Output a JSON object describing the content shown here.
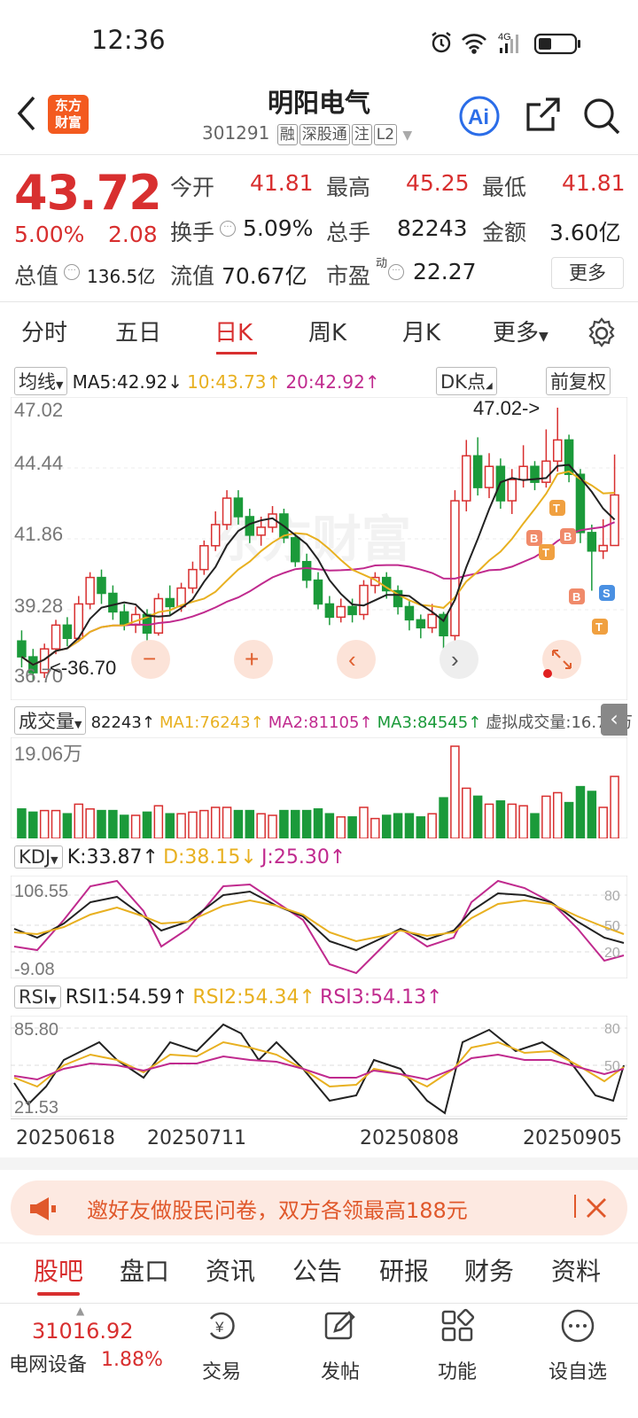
{
  "status": {
    "time": "12:36"
  },
  "header": {
    "logo_line1": "东方",
    "logo_line2": "财富",
    "title": "明阳电气",
    "code": "301291",
    "tags": [
      "融",
      "深股通",
      "注",
      "L2"
    ]
  },
  "quote": {
    "price": "43.72",
    "change_pct": "5.00%",
    "change": "2.08",
    "open_label": "今开",
    "open": "41.81",
    "high_label": "最高",
    "high": "45.25",
    "low_label": "最低",
    "low": "41.81",
    "turnover_label": "换手",
    "turnover": "5.09%",
    "vol_label": "总手",
    "vol": "82243",
    "amount_label": "金额",
    "amount": "3.60亿",
    "mktcap_label": "总值",
    "mktcap": "136.5亿",
    "float_label": "流值",
    "float": "70.67亿",
    "pe_label": "市盈",
    "pe_sup": "动",
    "pe": "22.27",
    "more": "更多"
  },
  "tabs": [
    "分时",
    "五日",
    "日K",
    "周K",
    "月K",
    "更多"
  ],
  "kline": {
    "ma_select": "均线",
    "ma5": "MA5:42.92↓",
    "ma10": "10:43.73↑",
    "ma20": "20:42.92↑",
    "dk": "DK点",
    "adjust": "前复权",
    "y_labels": [
      "47.02",
      "44.44",
      "41.86",
      "39.28",
      "36.70"
    ],
    "high_marker": "47.02->",
    "low_marker": "<-36.70",
    "watermark": "东方财富"
  },
  "volume": {
    "select": "成交量",
    "val": "82243↑",
    "ma1": "MA1:76243↑",
    "ma2": "MA2:81105↑",
    "ma3": "MA3:84545↑",
    "virtual": "虚拟成交量:16.78万",
    "max_label": "19.06万"
  },
  "kdj": {
    "select": "KDJ",
    "k": "K:33.87↑",
    "d": "D:38.15↓",
    "j": "J:25.30↑",
    "top": "106.55",
    "bottom": "-9.08",
    "r80": "80",
    "r50": "50",
    "r20": "20"
  },
  "rsi": {
    "select": "RSI",
    "r1": "RSI1:54.59↑",
    "r2": "RSI2:54.34↑",
    "r3": "RSI3:54.13↑",
    "top": "85.80",
    "bottom": "21.53",
    "r80": "80",
    "r50": "50"
  },
  "dates": [
    "20250618",
    "20250711",
    "20250808",
    "20250905"
  ],
  "banner": {
    "text": "邀好友做股民问卷，双方各领最高188元"
  },
  "feature_tabs": [
    "股吧",
    "盘口",
    "资讯",
    "公告",
    "研报",
    "财务",
    "资料"
  ],
  "bottom": {
    "index_value": "31016.92",
    "index_name": "电网设备",
    "index_pct": "1.88%",
    "items": [
      "交易",
      "发帖",
      "功能",
      "设自选"
    ]
  },
  "colors": {
    "up": "#d82f2f",
    "down": "#1b9a3a",
    "ma5": "#222222",
    "ma10": "#e8b020",
    "ma20": "#c02a8e"
  },
  "chart_data": {
    "type": "candlestick",
    "ylim": [
      36.7,
      47.02
    ],
    "candles": [
      {
        "o": 38.2,
        "c": 37.6,
        "h": 38.6,
        "l": 37.2
      },
      {
        "o": 37.6,
        "c": 37.0,
        "h": 37.9,
        "l": 36.7
      },
      {
        "o": 37.0,
        "c": 37.9,
        "h": 38.1,
        "l": 36.8
      },
      {
        "o": 37.9,
        "c": 38.8,
        "h": 39.0,
        "l": 37.7
      },
      {
        "o": 38.8,
        "c": 38.3,
        "h": 39.1,
        "l": 38.0
      },
      {
        "o": 38.3,
        "c": 39.6,
        "h": 39.9,
        "l": 38.2
      },
      {
        "o": 39.6,
        "c": 40.6,
        "h": 40.8,
        "l": 39.4
      },
      {
        "o": 40.6,
        "c": 40.0,
        "h": 40.9,
        "l": 39.6
      },
      {
        "o": 40.0,
        "c": 39.3,
        "h": 40.3,
        "l": 39.0
      },
      {
        "o": 39.3,
        "c": 38.8,
        "h": 39.6,
        "l": 38.6
      },
      {
        "o": 38.8,
        "c": 39.2,
        "h": 39.5,
        "l": 38.5
      },
      {
        "o": 39.2,
        "c": 38.5,
        "h": 39.4,
        "l": 38.2
      },
      {
        "o": 38.5,
        "c": 39.8,
        "h": 40.0,
        "l": 38.4
      },
      {
        "o": 39.8,
        "c": 39.5,
        "h": 40.3,
        "l": 39.2
      },
      {
        "o": 39.5,
        "c": 40.2,
        "h": 40.4,
        "l": 39.3
      },
      {
        "o": 40.2,
        "c": 40.9,
        "h": 41.2,
        "l": 40.0
      },
      {
        "o": 40.9,
        "c": 41.8,
        "h": 42.0,
        "l": 40.7
      },
      {
        "o": 41.8,
        "c": 42.6,
        "h": 43.1,
        "l": 41.6
      },
      {
        "o": 42.6,
        "c": 43.6,
        "h": 43.9,
        "l": 42.4
      },
      {
        "o": 43.6,
        "c": 42.9,
        "h": 43.9,
        "l": 42.6
      },
      {
        "o": 42.9,
        "c": 42.2,
        "h": 43.2,
        "l": 41.9
      },
      {
        "o": 42.2,
        "c": 42.5,
        "h": 42.9,
        "l": 41.8
      },
      {
        "o": 42.5,
        "c": 43.0,
        "h": 43.3,
        "l": 42.3
      },
      {
        "o": 43.0,
        "c": 42.1,
        "h": 43.2,
        "l": 41.9
      },
      {
        "o": 42.1,
        "c": 41.2,
        "h": 42.3,
        "l": 41.0
      },
      {
        "o": 41.2,
        "c": 40.5,
        "h": 41.5,
        "l": 40.2
      },
      {
        "o": 40.5,
        "c": 39.6,
        "h": 40.8,
        "l": 39.4
      },
      {
        "o": 39.6,
        "c": 39.1,
        "h": 39.9,
        "l": 38.8
      },
      {
        "o": 39.1,
        "c": 39.5,
        "h": 39.8,
        "l": 38.9
      },
      {
        "o": 39.5,
        "c": 39.2,
        "h": 39.8,
        "l": 38.9
      },
      {
        "o": 39.2,
        "c": 40.3,
        "h": 40.5,
        "l": 39.0
      },
      {
        "o": 40.3,
        "c": 40.6,
        "h": 40.8,
        "l": 40.0
      },
      {
        "o": 40.6,
        "c": 40.1,
        "h": 40.8,
        "l": 39.8
      },
      {
        "o": 40.1,
        "c": 39.5,
        "h": 40.3,
        "l": 39.2
      },
      {
        "o": 39.5,
        "c": 39.0,
        "h": 39.7,
        "l": 38.6
      },
      {
        "o": 39.0,
        "c": 38.7,
        "h": 39.2,
        "l": 38.3
      },
      {
        "o": 38.7,
        "c": 39.2,
        "h": 39.6,
        "l": 38.5
      },
      {
        "o": 39.2,
        "c": 38.4,
        "h": 39.3,
        "l": 37.2
      },
      {
        "o": 38.4,
        "c": 43.5,
        "h": 43.9,
        "l": 37.5
      },
      {
        "o": 43.5,
        "c": 45.2,
        "h": 45.8,
        "l": 43.1
      },
      {
        "o": 45.2,
        "c": 44.0,
        "h": 45.9,
        "l": 43.7
      },
      {
        "o": 44.0,
        "c": 44.8,
        "h": 45.3,
        "l": 43.6
      },
      {
        "o": 44.8,
        "c": 43.5,
        "h": 45.1,
        "l": 43.2
      },
      {
        "o": 43.5,
        "c": 44.3,
        "h": 44.7,
        "l": 43.0
      },
      {
        "o": 44.3,
        "c": 44.8,
        "h": 45.6,
        "l": 44.0
      },
      {
        "o": 44.8,
        "c": 44.2,
        "h": 45.0,
        "l": 43.9
      },
      {
        "o": 44.2,
        "c": 45.0,
        "h": 46.2,
        "l": 44.0
      },
      {
        "o": 45.0,
        "c": 45.8,
        "h": 47.02,
        "l": 44.6
      },
      {
        "o": 45.8,
        "c": 44.5,
        "h": 46.0,
        "l": 44.2
      },
      {
        "o": 44.5,
        "c": 42.3,
        "h": 44.7,
        "l": 41.9
      },
      {
        "o": 42.3,
        "c": 41.6,
        "h": 42.6,
        "l": 40.1
      },
      {
        "o": 41.6,
        "c": 41.81,
        "h": 42.8,
        "l": 41.3
      },
      {
        "o": 41.81,
        "c": 43.72,
        "h": 45.25,
        "l": 41.81
      }
    ]
  }
}
